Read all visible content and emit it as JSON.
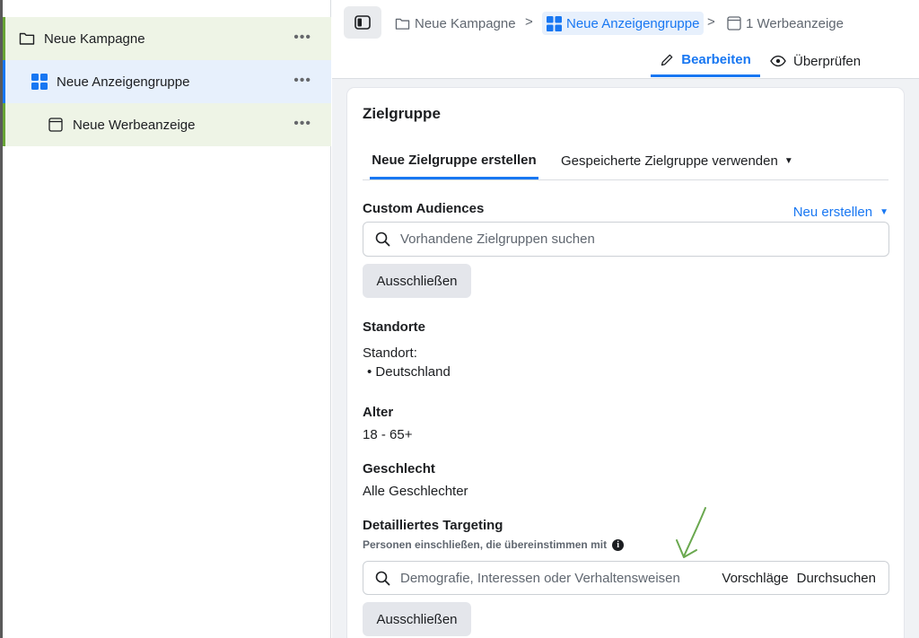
{
  "sidebar": {
    "items": [
      {
        "label": "Neue Kampagne",
        "icon": "folder-icon",
        "more": "•••"
      },
      {
        "label": "Neue Anzeigengruppe",
        "icon": "grid-icon",
        "more": "•••"
      },
      {
        "label": "Neue Werbeanzeige",
        "icon": "ad-frame-icon",
        "more": "•••"
      }
    ]
  },
  "header": {
    "toggle_icon": "panel-toggle-icon",
    "breadcrumbs": [
      {
        "label": "Neue Kampagne",
        "icon": "folder-icon"
      },
      {
        "label": "Neue Anzeigengruppe",
        "icon": "grid-icon"
      },
      {
        "label": "1 Werbeanzeige",
        "icon": "ad-frame-icon"
      }
    ],
    "separator": ">",
    "tabs": {
      "edit": "Bearbeiten",
      "review": "Überprüfen"
    }
  },
  "audience": {
    "title": "Zielgruppe",
    "tab_create": "Neue Zielgruppe erstellen",
    "tab_saved": "Gespeicherte Zielgruppe verwenden",
    "custom_audiences": {
      "label": "Custom Audiences",
      "new_link": "Neu erstellen",
      "search_placeholder": "Vorhandene Zielgruppen suchen",
      "exclude_button": "Ausschließen"
    },
    "locations": {
      "label": "Standorte",
      "sub": "Standort:",
      "items": [
        "Deutschland"
      ]
    },
    "age": {
      "label": "Alter",
      "value": "18 - 65+"
    },
    "gender": {
      "label": "Geschlecht",
      "value": "Alle Geschlechter"
    },
    "detailed": {
      "label": "Detailliertes Targeting",
      "note": "Personen einschließen, die übereinstimmen mit",
      "search_placeholder": "Demografie, Interessen oder Verhaltensweisen",
      "suggestions": "Vorschläge",
      "browse": "Durchsuchen",
      "exclude_button": "Ausschließen"
    }
  },
  "colors": {
    "accent": "#1877f2",
    "campaign_green": "#68a536",
    "annotation_arrow": "#6aa84f"
  }
}
